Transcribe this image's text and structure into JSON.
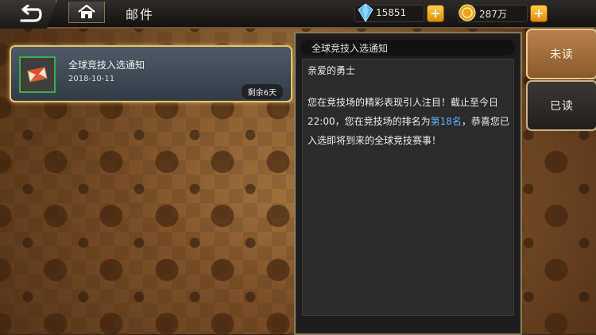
{
  "header": {
    "title": "邮件",
    "gems": "15851",
    "gold": "287万"
  },
  "mail_list": [
    {
      "title": "全球竞技入选通知",
      "date": "2018-10-11",
      "remaining": "剩余6天"
    }
  ],
  "detail": {
    "heading": "全球竞技入选通知",
    "greeting": "亲爱的勇士",
    "body_part1": "您在竞技场的精彩表现引人注目！截止至今日22:00，您在竞技场的排名为",
    "rank": "第18名",
    "body_part2": "，恭喜您已入选即将到来的全球竞技赛事！"
  },
  "tabs": {
    "unread": "未读",
    "read": "已读"
  },
  "colors": {
    "accent_gold": "#e8c46a",
    "highlight_blue": "#5fb0ff",
    "selected_border_green": "#34b04a"
  }
}
